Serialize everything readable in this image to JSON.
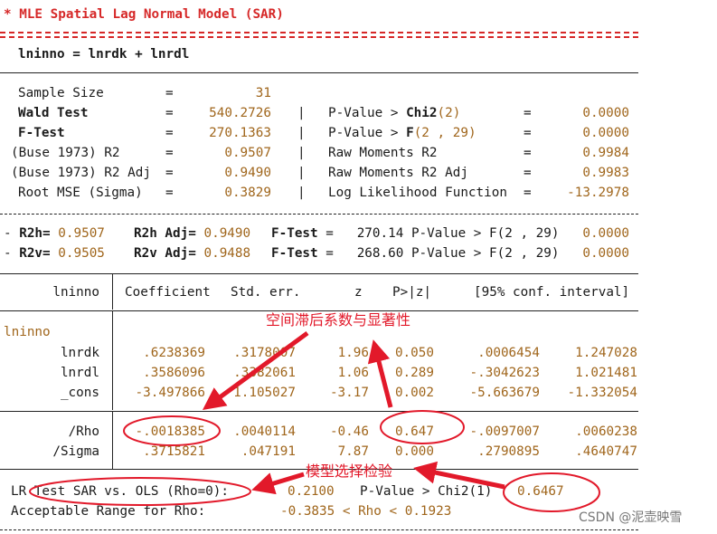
{
  "title": "* MLE Spatial Lag Normal Model (SAR)",
  "equation": "lninno = lnrdk + lnrdl",
  "stats_left": [
    {
      "label": "Sample Size",
      "eq": "=",
      "value": "31",
      "bold": false
    },
    {
      "label": "Wald Test",
      "eq": "=",
      "value": "540.2726",
      "bold": true
    },
    {
      "label": "F-Test",
      "eq": "=",
      "value": "270.1363",
      "bold": true
    },
    {
      "label": "(Buse 1973) R2",
      "eq": "=",
      "value": "0.9507",
      "bold": false
    },
    {
      "label": "(Buse 1973) R2 Adj",
      "eq": "=",
      "value": "0.9490",
      "bold": false
    },
    {
      "label": "Root MSE (Sigma)",
      "eq": "=",
      "value": "0.3829",
      "bold": false
    }
  ],
  "stats_right": [
    {
      "pre": "P-Value > ",
      "bold": "Chi2",
      "post": "(2)",
      "eq": "=",
      "value": "0.0000"
    },
    {
      "pre": "P-Value > ",
      "bold": "F",
      "post": "(2 , 29)",
      "eq": "=",
      "value": "0.0000"
    },
    {
      "pre": "Raw Moments R2",
      "bold": "",
      "post": "",
      "eq": "=",
      "value": "0.9984"
    },
    {
      "pre": "Raw Moments R2 Adj",
      "bold": "",
      "post": "",
      "eq": "=",
      "value": "0.9983"
    },
    {
      "pre": "Log Likelihood Function",
      "bold": "",
      "post": "",
      "eq": "=",
      "value": "-13.2978"
    }
  ],
  "sep_bar": "|",
  "r2_rows": [
    {
      "dash": "- ",
      "l1": "R2h=",
      "v1": " 0.9507",
      "l2": "R2h Adj=",
      "v2": " 0.9490",
      "l3": "F-Test",
      "v3": "=   270.14 P-Value > F(2 , 29)",
      "v4": "0.0000"
    },
    {
      "dash": "- ",
      "l1": "R2v=",
      "v1": " 0.9505",
      "l2": "R2v Adj=",
      "v2": " 0.9488",
      "l3": "F-Test",
      "v3": "=   268.60 P-Value > F(2 , 29)",
      "v4": "0.0000"
    }
  ],
  "table": {
    "dep_header": "lninno",
    "headers": [
      "Coefficient",
      "Std. err.",
      "z",
      "P>|z|",
      "[95% conf. interval]"
    ],
    "group": "lninno",
    "rows": [
      {
        "name": "lnrdk",
        "cells": [
          ".6238369",
          ".3178007",
          "1.96",
          "0.050",
          ".0006454",
          "1.247028"
        ]
      },
      {
        "name": "lnrdl",
        "cells": [
          ".3586096",
          ".3382061",
          "1.06",
          "0.289",
          "-.3042623",
          "1.021481"
        ]
      },
      {
        "name": "_cons",
        "cells": [
          "-3.497866",
          "1.105027",
          "-3.17",
          "0.002",
          "-5.663679",
          "-1.332054"
        ]
      }
    ],
    "rows2": [
      {
        "name": "/Rho",
        "cells": [
          "-.0018385",
          ".0040114",
          "-0.46",
          "0.647",
          "-.0097007",
          ".0060238"
        ]
      },
      {
        "name": "/Sigma",
        "cells": [
          ".3715821",
          ".047191",
          "7.87",
          "0.000",
          ".2790895",
          ".4640747"
        ]
      }
    ]
  },
  "lr_test": {
    "label": "LR Test SAR vs. OLS (Rho=0):",
    "value": "0.2100",
    "pv": "P-Value > Chi2(1)",
    "pval": "0.6467"
  },
  "rho_range": {
    "label": "Acceptable Range for Rho:",
    "range": "-0.3835 < Rho < 0.1923"
  },
  "annotations": {
    "spatial_coef": "空间滞后系数与显著性",
    "model_test": "模型选择检验"
  },
  "watermark": "CSDN @泥壶映雪",
  "colors": {
    "title": "#d62828",
    "value": "#a0661c",
    "annotation": "#e2192a",
    "rule": "#222222"
  }
}
